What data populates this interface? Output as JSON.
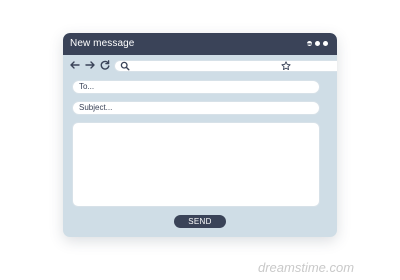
{
  "window": {
    "title": "New message",
    "menu_dots_icon": "ellipsis-icon"
  },
  "toolbar": {
    "back_icon": "arrow-left-icon",
    "forward_icon": "arrow-right-icon",
    "reload_icon": "reload-icon",
    "search_icon": "search-icon",
    "bookmark_icon": "star-icon",
    "menu_icon": "hamburger-menu-icon"
  },
  "compose": {
    "to_placeholder": "To...",
    "subject_placeholder": "Subject...",
    "body_value": "",
    "send_label": "SEND"
  },
  "colors": {
    "window_bg": "#cfdde6",
    "titlebar": "#3a4358",
    "field_bg": "#ffffff"
  },
  "watermark": "dreamstime.com"
}
